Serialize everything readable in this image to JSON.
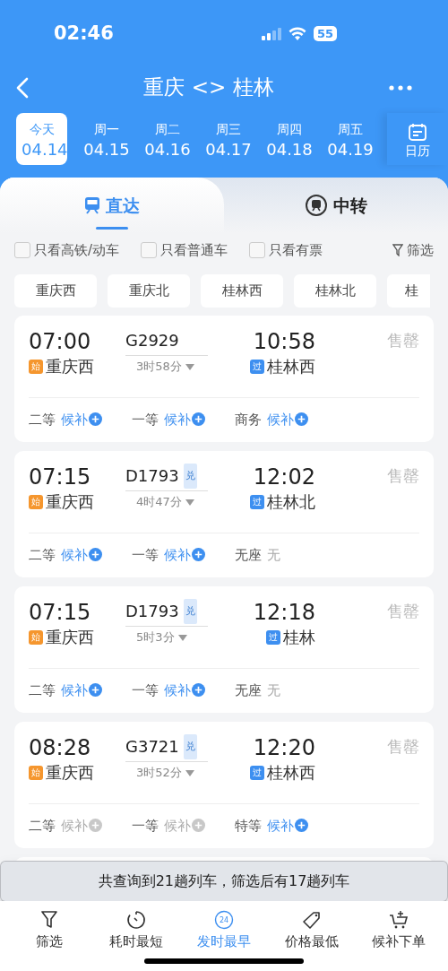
{
  "status_bar": {
    "time": "02:46",
    "battery": "55"
  },
  "header": {
    "title": "重庆 <> 桂林"
  },
  "dates": [
    {
      "weekday": "今天",
      "date": "04.14",
      "selected": true
    },
    {
      "weekday": "周一",
      "date": "04.15",
      "selected": false
    },
    {
      "weekday": "周二",
      "date": "04.16",
      "selected": false
    },
    {
      "weekday": "周三",
      "date": "04.17",
      "selected": false
    },
    {
      "weekday": "周四",
      "date": "04.18",
      "selected": false
    },
    {
      "weekday": "周五",
      "date": "04.19",
      "selected": false
    }
  ],
  "calendar_button": {
    "label": "日历"
  },
  "mode_tabs": [
    {
      "label": "直达",
      "selected": true
    },
    {
      "label": "中转",
      "selected": false
    }
  ],
  "filters": [
    {
      "label": "只看高铁/动车",
      "checked": false
    },
    {
      "label": "只看普通车",
      "checked": false
    },
    {
      "label": "只看有票",
      "checked": false
    }
  ],
  "filter_button": {
    "label": "筛选"
  },
  "stations": [
    "重庆西",
    "重庆北",
    "桂林西",
    "桂林北",
    "桂"
  ],
  "trains": [
    {
      "depart": "07:00",
      "from_badge": "始",
      "from": "重庆西",
      "number": "G2929",
      "duration": "3时58分",
      "arrive": "10:58",
      "to_badge": "过",
      "to": "桂林西",
      "status": "售罄",
      "seats": [
        {
          "kind": "waitlist",
          "class": "二等",
          "availability": "候补",
          "enabled": true
        },
        {
          "kind": "waitlist",
          "class": "一等",
          "availability": "候补",
          "enabled": true
        },
        {
          "kind": "waitlist",
          "class": "商务",
          "availability": "候补",
          "enabled": true
        }
      ]
    },
    {
      "depart": "07:15",
      "from_badge": "始",
      "from": "重庆西",
      "number": "D1793",
      "exchange_badge": "兑",
      "duration": "4时47分",
      "arrive": "12:02",
      "to_badge": "过",
      "to": "桂林北",
      "status": "售罄",
      "seats": [
        {
          "kind": "waitlist",
          "class": "二等",
          "availability": "候补",
          "enabled": true
        },
        {
          "kind": "waitlist",
          "class": "一等",
          "availability": "候补",
          "enabled": true
        },
        {
          "kind": "text",
          "class": "无座",
          "availability": "无"
        }
      ]
    },
    {
      "depart": "07:15",
      "from_badge": "始",
      "from": "重庆西",
      "number": "D1793",
      "exchange_badge": "兑",
      "duration": "5时3分",
      "arrive": "12:18",
      "to_badge": "过",
      "to": "桂林",
      "status": "售罄",
      "seats": [
        {
          "kind": "waitlist",
          "class": "二等",
          "availability": "候补",
          "enabled": true
        },
        {
          "kind": "waitlist",
          "class": "一等",
          "availability": "候补",
          "enabled": true
        },
        {
          "kind": "text",
          "class": "无座",
          "availability": "无"
        }
      ]
    },
    {
      "depart": "08:28",
      "from_badge": "始",
      "from": "重庆西",
      "number": "G3721",
      "exchange_badge": "兑",
      "duration": "3时52分",
      "arrive": "12:20",
      "to_badge": "过",
      "to": "桂林西",
      "status": "售罄",
      "seats": [
        {
          "kind": "waitlist",
          "class": "二等",
          "availability": "候补",
          "enabled": false
        },
        {
          "kind": "waitlist",
          "class": "一等",
          "availability": "候补",
          "enabled": false
        },
        {
          "kind": "waitlist",
          "class": "特等",
          "availability": "候补",
          "enabled": true
        }
      ]
    }
  ],
  "toast": "共查询到21趟列车，筛选后有17趟列车",
  "sort_bar": [
    {
      "label": "筛选",
      "selected": false
    },
    {
      "label": "耗时最短",
      "selected": false
    },
    {
      "icon_text": "24",
      "label": "发时最早",
      "selected": true
    },
    {
      "label": "价格最低",
      "selected": false
    },
    {
      "label": "候补下单",
      "selected": false
    }
  ]
}
